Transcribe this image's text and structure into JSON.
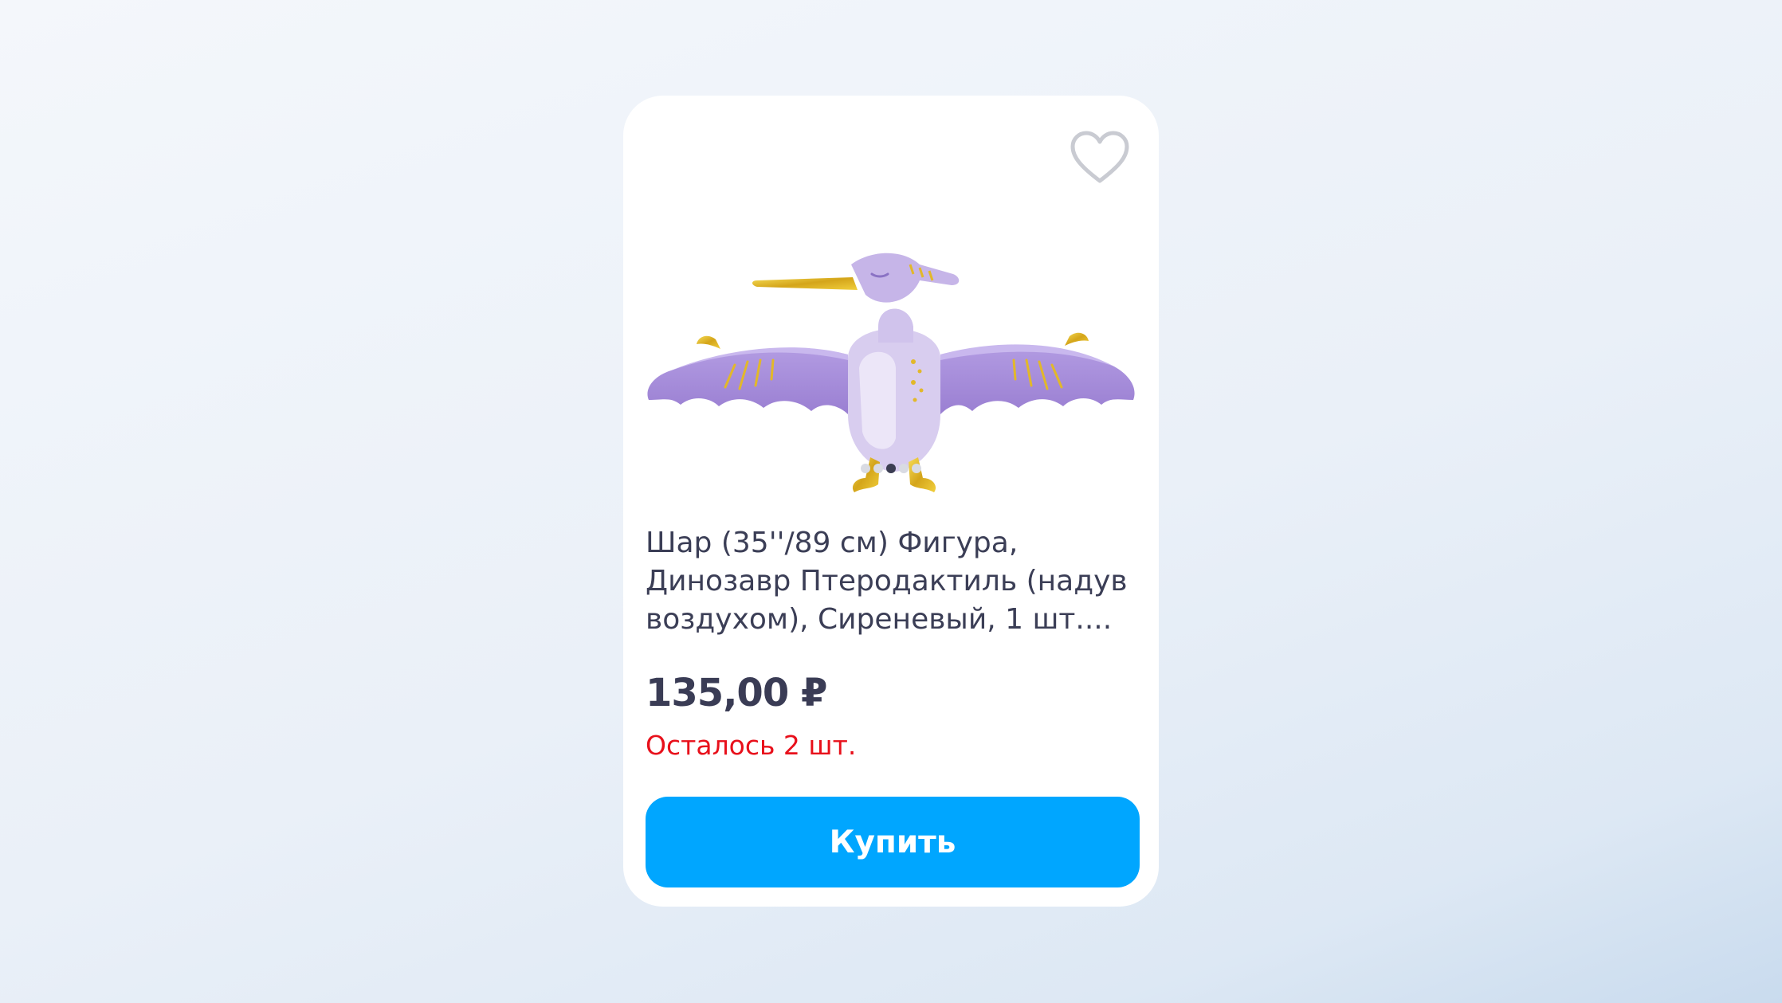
{
  "product": {
    "title": "Шар (35''/89 см) Фигура,\nДинозавр Птеродактиль (надув\nвоздухом), Сиреневый, 1 шт....",
    "price": "135,00 ₽",
    "stock_note": "Осталось 2 шт.",
    "buy_label": "Купить",
    "image_count": 5,
    "active_image_index": 2
  },
  "icons": {
    "favorite": "heart-outline-icon"
  },
  "colors": {
    "accent": "#00a6ff",
    "price_text": "#3a3c55",
    "stock_warning": "#e8101b",
    "card_background": "#ffffff"
  }
}
